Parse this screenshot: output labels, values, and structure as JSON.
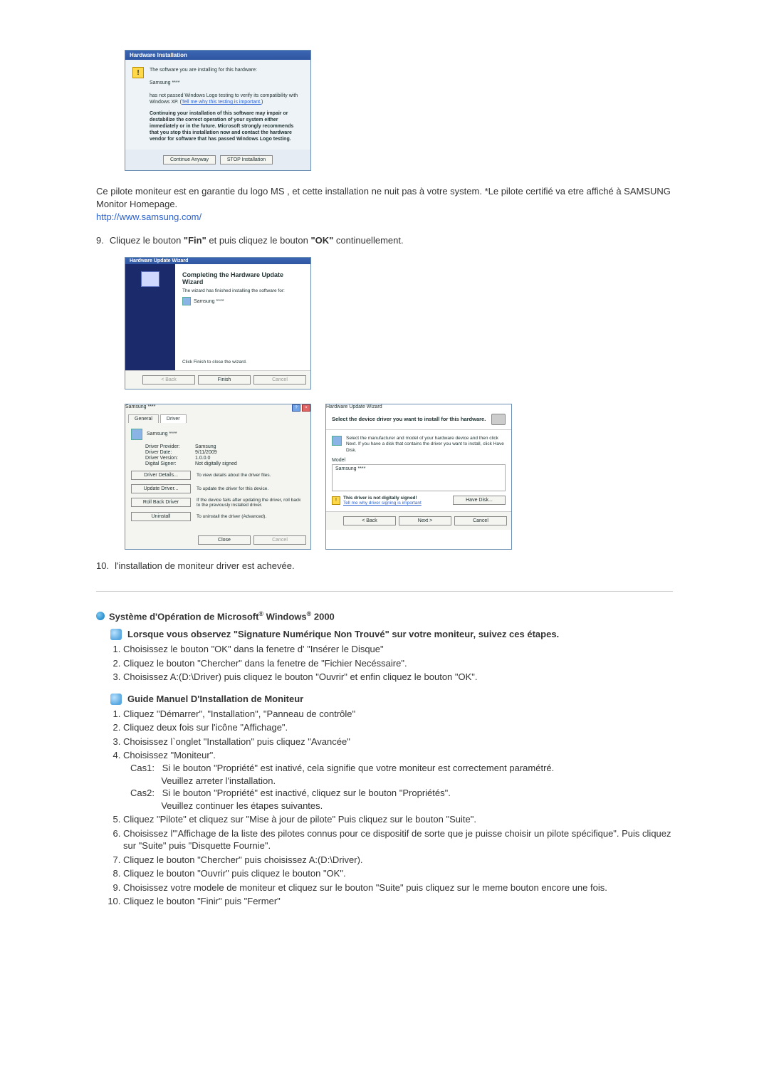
{
  "hwinst": {
    "title": "Hardware Installation",
    "line1": "The software you are installing for this hardware:",
    "device": "Samsung ****",
    "line2a": "has not passed Windows Logo testing to verify its compatibility with Windows XP. (",
    "tellme": "Tell me why this testing is important.",
    "line2b": ")",
    "bold": "Continuing your installation of this software may impair or destabilize the correct operation of your system either immediately or in the future. Microsoft strongly recommends that you stop this installation now and contact the hardware vendor for software that has passed Windows Logo testing.",
    "btn_continue": "Continue Anyway",
    "btn_stop": "STOP Installation"
  },
  "para1": {
    "text1": "Ce pilote moniteur est en garantie du logo MS , et cette installation ne nuit pas à votre system. *Le pilote certifié va etre affiché à SAMSUNG Monitor Homepage.",
    "link": "http://www.samsung.com/"
  },
  "step9": {
    "num": "9.",
    "text_pre": "Cliquez le bouton ",
    "fin": "\"Fin\"",
    "text_mid": " et puis cliquez le bouton ",
    "ok": "\"OK\"",
    "text_post": " continuellement."
  },
  "wiz_complete": {
    "title": "Hardware Update Wizard",
    "hdr": "Completing the Hardware Update Wizard",
    "line1": "The wizard has finished installing the software for:",
    "device": "Samsung ****",
    "line2": "Click Finish to close the wizard.",
    "btn_back": "< Back",
    "btn_finish": "Finish",
    "btn_cancel": "Cancel"
  },
  "props": {
    "title": "Samsung ****",
    "tab_general": "General",
    "tab_driver": "Driver",
    "device": "Samsung ****",
    "kv": {
      "provider_k": "Driver Provider:",
      "provider_v": "Samsung",
      "date_k": "Driver Date:",
      "date_v": "9/11/2009",
      "version_k": "Driver Version:",
      "version_v": "1.0.0.0",
      "signer_k": "Digital Signer:",
      "signer_v": "Not digitally signed"
    },
    "btn_details": "Driver Details...",
    "txt_details": "To view details about the driver files.",
    "btn_update": "Update Driver...",
    "txt_update": "To update the driver for this device.",
    "btn_rollback": "Roll Back Driver",
    "txt_rollback": "If the device fails after updating the driver, roll back to the previously installed driver.",
    "btn_uninstall": "Uninstall",
    "txt_uninstall": "To uninstall the driver (Advanced).",
    "btn_close": "Close",
    "btn_cancel": "Cancel"
  },
  "selwiz": {
    "title": "Hardware Update Wizard",
    "hdr": "Select the device driver you want to install for this hardware.",
    "info": "Select the manufacturer and model of your hardware device and then click Next. If you have a disk that contains the driver you want to install, click Have Disk.",
    "list_label": "Model",
    "list_item": "Samsung ****",
    "sig_bold": "This driver is not digitally signed!",
    "sig_link": "Tell me why driver signing is important",
    "btn_disk": "Have Disk...",
    "btn_back": "< Back",
    "btn_next": "Next >",
    "btn_cancel": "Cancel"
  },
  "step10": {
    "num": "10.",
    "text": "l'installation de moniteur driver est achevée."
  },
  "sec2000": {
    "title_pre": "Système d'Opération de Microsoft",
    "title_reg1": "®",
    "title_mid": " Windows",
    "title_reg2": "®",
    "title_post": " 2000"
  },
  "sub1": {
    "title": "Lorsque vous observez \"Signature Numérique Non Trouvé\" sur votre moniteur, suivez ces étapes.",
    "items": [
      "Choisissez le bouton \"OK\" dans la fenetre d' \"Insérer le Disque\"",
      "Cliquez le bouton \"Chercher\" dans la fenetre de \"Fichier Necéssaire\".",
      "Choisissez A:(D:\\Driver) puis cliquez le bouton \"Ouvrir\" et enfin cliquez le bouton \"OK\"."
    ]
  },
  "sub2": {
    "title": "Guide Manuel D'Installation de Moniteur",
    "items": [
      "Cliquez \"Démarrer\", \"Installation\", \"Panneau de contrôle\"",
      "Cliquez deux fois sur l'icône \"Affichage\".",
      "Choisissez l`onglet \"Installation\" puis cliquez \"Avancée\"",
      "Choisissez \"Moniteur\".",
      "Cliquez \"Pilote\" et cliquez sur \"Mise à jour de pilote\" Puis cliquez sur le bouton \"Suite\".",
      "Choisissez l'\"Affichage de la liste des pilotes connus pour ce dispositif de sorte que je puisse choisir un pilote spécifique\". Puis cliquez sur \"Suite\" puis \"Disquette Fournie\".",
      "Cliquez le bouton \"Chercher\" puis choisissez A:(D:\\Driver).",
      "Cliquez le bouton \"Ouvrir\" puis cliquez le bouton \"OK\".",
      "Choisissez votre modele de moniteur et cliquez sur le bouton \"Suite\" puis cliquez sur le meme bouton encore une fois.",
      "Cliquez le bouton \"Finir\" puis \"Fermer\""
    ],
    "cas1": "Cas1:   Si le bouton \"Propriété\" est inativé, cela signifie que votre moniteur est correctement paramétré.\n            Veuillez arreter l'installation.",
    "cas2": "Cas2:   Si le bouton \"Propriété\" est inactivé, cliquez sur le bouton \"Propriétés\".\n            Veuillez continuer les étapes suivantes."
  }
}
